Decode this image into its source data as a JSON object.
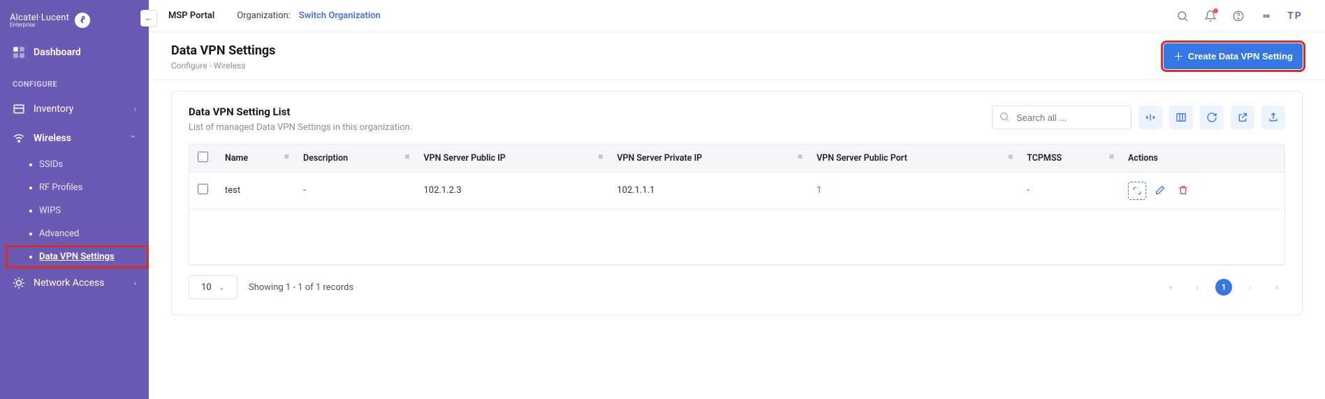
{
  "brand": {
    "name": "Alcatel·Lucent",
    "sub": "Enterprise",
    "glyph": "ℓ"
  },
  "topbar": {
    "portal": "MSP Portal",
    "org_label": "Organization:",
    "org_link": "Switch Organization",
    "user_initials": "TP"
  },
  "sidebar": {
    "dashboard": "Dashboard",
    "configure_label": "CONFIGURE",
    "inventory": "Inventory",
    "wireless": "Wireless",
    "wireless_items": {
      "ssids": "SSIDs",
      "rf": "RF Profiles",
      "wips": "WIPS",
      "advanced": "Advanced",
      "datavpn": "Data VPN Settings"
    },
    "network_access": "Network Access"
  },
  "page": {
    "title": "Data VPN Settings",
    "crumb1": "Configure",
    "crumb_sep": "  -  ",
    "crumb2": "Wireless",
    "create_btn": "Create Data VPN Setting"
  },
  "card": {
    "title": "Data VPN Setting List",
    "subtitle": "List of managed Data VPN Settings in this organization.",
    "search_placeholder": "Search all ..."
  },
  "table": {
    "cols": {
      "name": "Name",
      "desc": "Description",
      "pubip": "VPN Server Public IP",
      "privip": "VPN Server Private IP",
      "pubport": "VPN Server Public Port",
      "tcpmss": "TCPMSS",
      "actions": "Actions"
    },
    "rows": [
      {
        "name": "test",
        "desc": "-",
        "pubip": "102.1.2.3",
        "privip": "102.1.1.1",
        "pubport": "1",
        "tcpmss": "-"
      }
    ]
  },
  "footer": {
    "page_size": "10",
    "info": "Showing 1 - 1 of 1 records",
    "current_page": "1"
  }
}
